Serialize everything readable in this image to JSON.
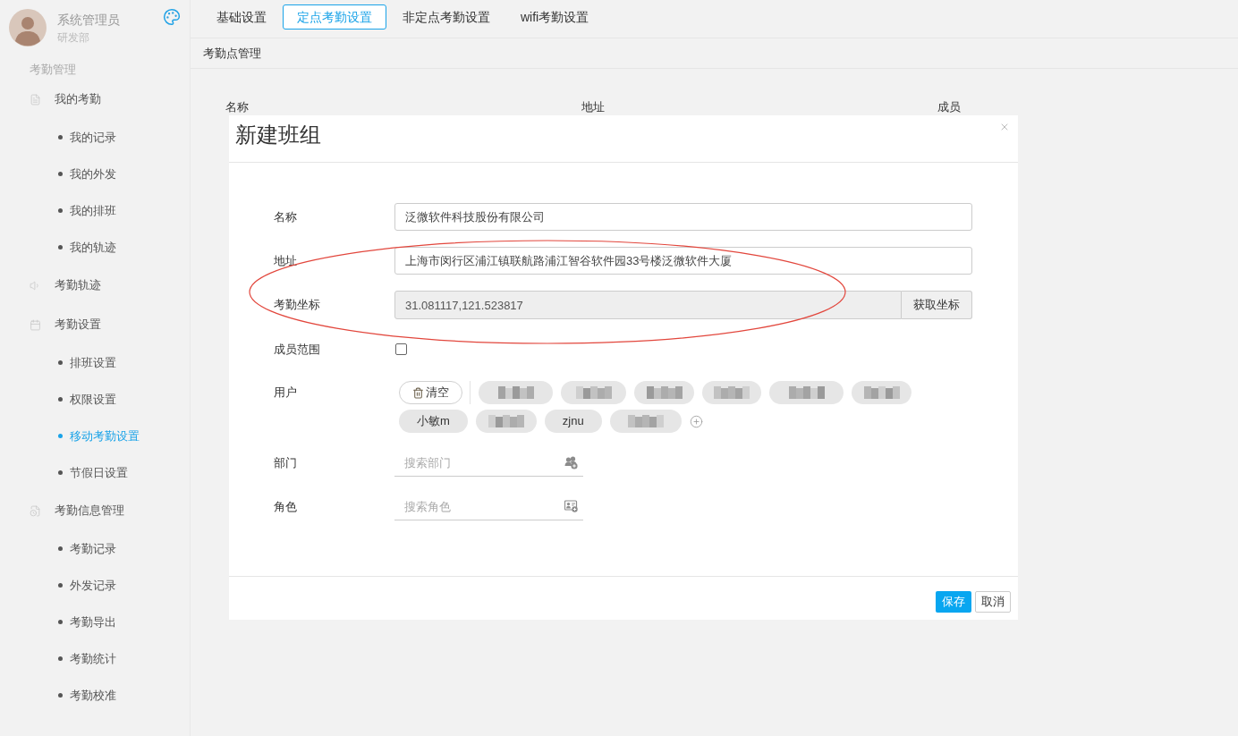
{
  "sidebar": {
    "user": {
      "name": "系统管理员",
      "department": "研发部"
    },
    "section_title": "考勤管理",
    "items": [
      {
        "label": "我的考勤",
        "selected": false,
        "children": [
          {
            "label": "我的记录",
            "selected": false
          },
          {
            "label": "我的外发",
            "selected": false
          },
          {
            "label": "我的排班",
            "selected": false
          },
          {
            "label": "我的轨迹",
            "selected": false
          }
        ]
      },
      {
        "label": "考勤轨迹",
        "selected": false
      },
      {
        "label": "考勤设置",
        "selected": false,
        "children": [
          {
            "label": "排班设置",
            "selected": false
          },
          {
            "label": "权限设置",
            "selected": false
          },
          {
            "label": "移动考勤设置",
            "selected": true
          },
          {
            "label": "节假日设置",
            "selected": false
          }
        ]
      },
      {
        "label": "考勤信息管理",
        "selected": false,
        "children": [
          {
            "label": "考勤记录",
            "selected": false
          },
          {
            "label": "外发记录",
            "selected": false
          },
          {
            "label": "考勤导出",
            "selected": false
          },
          {
            "label": "考勤统计",
            "selected": false
          },
          {
            "label": "考勤校准",
            "selected": false
          }
        ]
      }
    ]
  },
  "tabs": [
    {
      "label": "基础设置",
      "selected": false
    },
    {
      "label": "定点考勤设置",
      "selected": true
    },
    {
      "label": "非定点考勤设置",
      "selected": false
    },
    {
      "label": "wifi考勤设置",
      "selected": false
    }
  ],
  "page": {
    "section_title": "考勤点管理",
    "table": {
      "columns": [
        "名称",
        "地址",
        "成员"
      ]
    }
  },
  "dialog": {
    "title": "新建班组",
    "fields": [
      {
        "kind": "text",
        "label": "名称",
        "value": "泛微软件科技股份有限公司"
      },
      {
        "kind": "text",
        "label": "地址",
        "value": "上海市闵行区浦江镇联航路浦江智谷软件园33号楼泛微软件大厦"
      },
      {
        "kind": "coordinate",
        "label": "考勤坐标",
        "value": "31.081117,121.523817",
        "disabled": true,
        "button": "获取坐标"
      },
      {
        "kind": "checkbox",
        "label": "成员范围",
        "checked": false
      },
      {
        "kind": "users",
        "label": "用户",
        "chips": [
          {
            "kind": "clear",
            "label": "清空"
          },
          {
            "kind": "blurred"
          },
          {
            "kind": "blurred"
          },
          {
            "kind": "blurred"
          },
          {
            "kind": "blurred"
          },
          {
            "kind": "blurred"
          },
          {
            "kind": "blurred"
          },
          {
            "kind": "name",
            "label": "小敏m"
          },
          {
            "kind": "blurred"
          },
          {
            "kind": "name",
            "label": "zjnu"
          },
          {
            "kind": "blurred"
          }
        ]
      },
      {
        "kind": "search",
        "label": "部门",
        "placeholder": "搜索部门"
      },
      {
        "kind": "search",
        "label": "角色",
        "placeholder": "搜索角色"
      }
    ],
    "buttons": [
      {
        "kind": "primary",
        "label": "保存"
      },
      {
        "kind": "default",
        "label": "取消"
      }
    ]
  }
}
